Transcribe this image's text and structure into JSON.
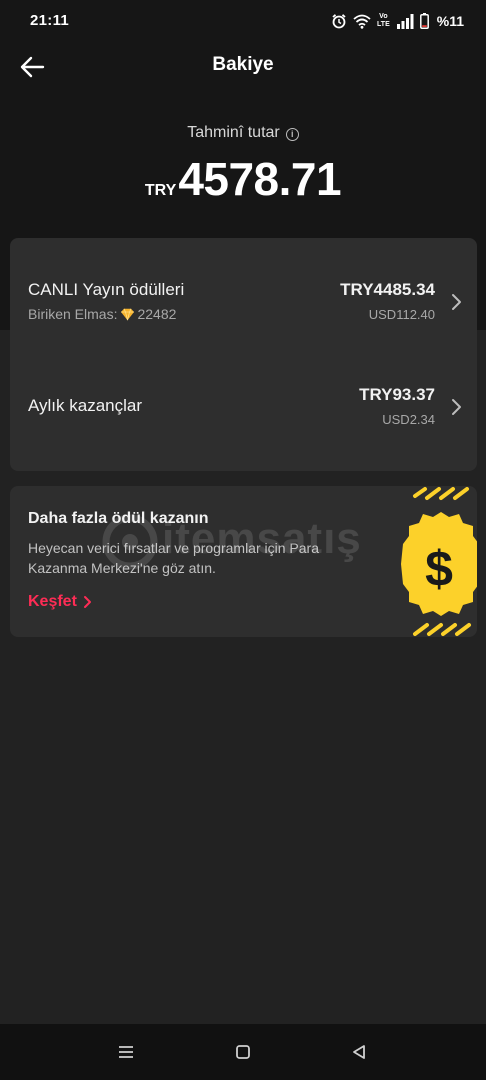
{
  "status_bar": {
    "time": "21:11",
    "battery": "%11",
    "volte_top": "Vo",
    "volte_bottom": "LTE"
  },
  "header": {
    "title": "Bakiye",
    "back_icon": "arrow-left-icon"
  },
  "balance": {
    "label": "Tahminî tutar",
    "info_glyph": "i",
    "currency": "TRY",
    "amount": "4578.71"
  },
  "rewards": {
    "live": {
      "title": "CANLI Yayın ödülleri",
      "sub_label": "Biriken Elmas:",
      "diamonds": "22482",
      "amount": "TRY4485.34",
      "usd": "USD112.40"
    },
    "monthly": {
      "title": "Aylık kazançlar",
      "amount": "TRY93.37",
      "usd": "USD2.34"
    }
  },
  "promo": {
    "title": "Daha fazla ödül kazanın",
    "description": "Heyecan verici fırsatlar ve programlar için Para Kazanma Merkezi'ne göz atın.",
    "link": "Keşfet",
    "art_icon": "dollar-coin-icon"
  },
  "watermark": {
    "text": "itemsatış"
  },
  "colors": {
    "background": "#222222",
    "top_background": "#161616",
    "card": "#2e2e2e",
    "accent": "#fe2c55",
    "coin": "#fcd12a"
  },
  "nav": {
    "icons": [
      "menu-icon",
      "home-square-icon",
      "back-triangle-icon"
    ]
  }
}
